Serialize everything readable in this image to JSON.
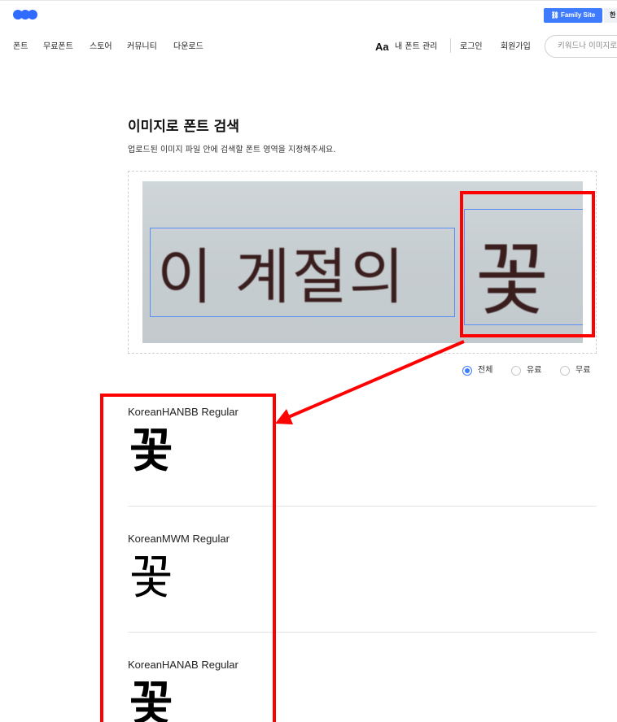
{
  "header": {
    "family_site_label": "Family Site",
    "lang_label": "한"
  },
  "nav": {
    "items": [
      "폰트",
      "무료폰트",
      "스토어",
      "커뮤니티",
      "다운로드"
    ],
    "aa_label": "Aa",
    "my_fonts_label": "내 폰트 관리",
    "login_label": "로그인",
    "signup_label": "회원가입",
    "search_placeholder": "키워드나 이미지로"
  },
  "main": {
    "title": "이미지로 폰트 검색",
    "subtitle": "업로드된 이미지 파일 안에 검색할 폰트 영역을 지정해주세요.",
    "image_text": "이 계절의",
    "image_glyph": "꽃"
  },
  "filters": {
    "options": [
      "전체",
      "유료",
      "무료"
    ],
    "selected": "전체"
  },
  "results": [
    {
      "name": "KoreanHANBB Regular",
      "glyph": "꽃"
    },
    {
      "name": "KoreanMWM Regular",
      "glyph": "꽃"
    },
    {
      "name": "KoreanHANAB Regular",
      "glyph": "꽃"
    }
  ],
  "colors": {
    "accent": "#3e7bff",
    "annotation": "#ff0000",
    "selection": "#5b8df5"
  }
}
